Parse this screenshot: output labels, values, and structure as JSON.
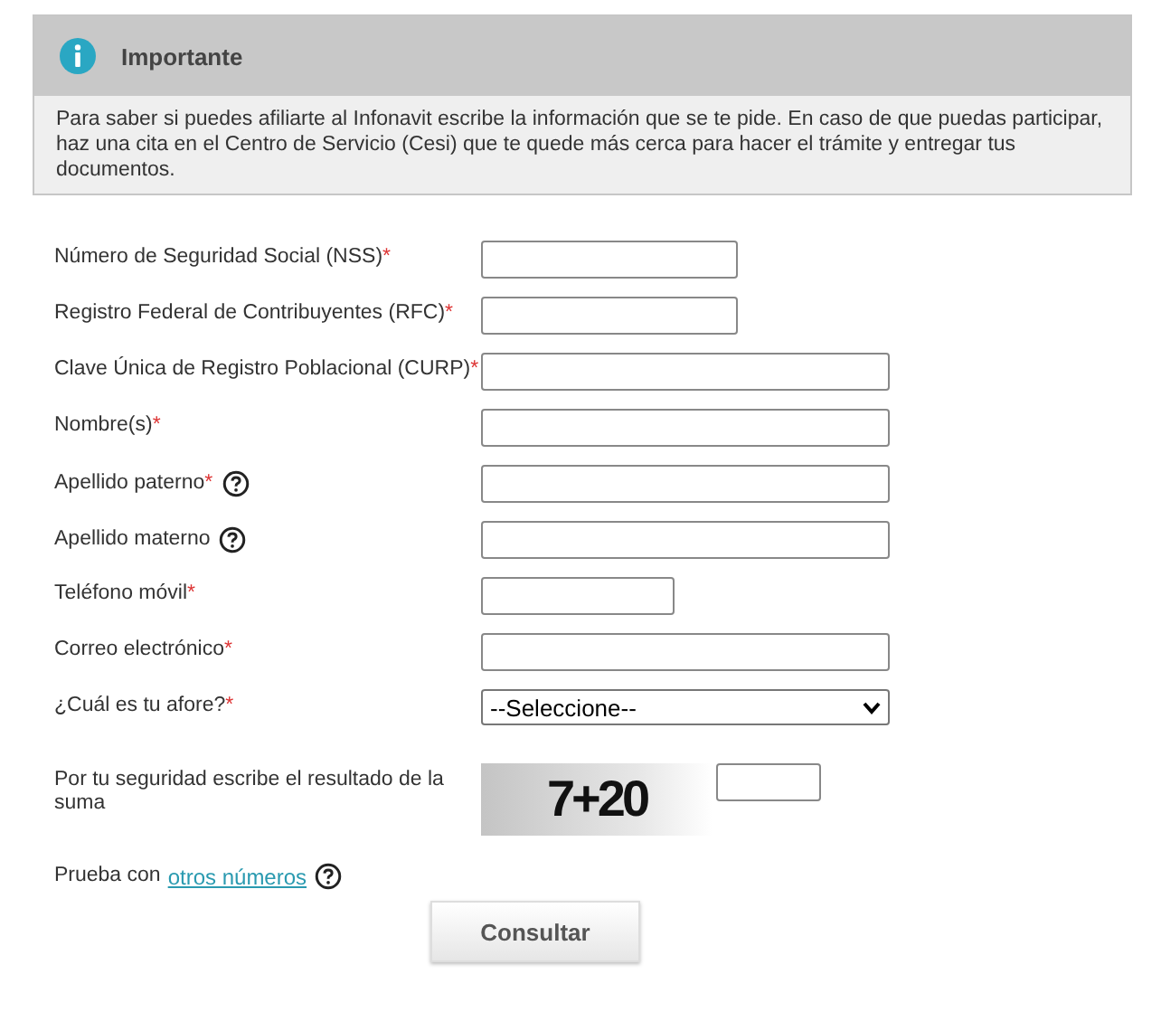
{
  "notice": {
    "title": "Importante",
    "text": "Para saber si puedes afiliarte al Infonavit escribe la información que se te pide. En caso de que puedas participar, haz una cita en el Centro de Servicio (Cesi) que te quede más cerca para hacer el trámite y entregar tus documentos."
  },
  "fields": [
    {
      "label": "Número de Seguridad Social (NSS)",
      "required_mark": "*",
      "help": false,
      "kind": "short"
    },
    {
      "label": "Registro Federal de Contribuyentes (RFC)",
      "required_mark": "*",
      "help": false,
      "kind": "short"
    },
    {
      "label": "Clave Única de Registro Poblacional (CURP)",
      "required_mark": "*",
      "help": false,
      "kind": "long"
    },
    {
      "label": "Nombre(s)",
      "required_mark": "*",
      "help": false,
      "kind": "long"
    },
    {
      "label": "Apellido paterno",
      "required_mark": "*",
      "help": true,
      "kind": "long"
    },
    {
      "label": "Apellido materno",
      "help": true,
      "kind": "long"
    },
    {
      "label": "Teléfono móvil",
      "required_mark": "*",
      "help": false,
      "kind": "phone"
    },
    {
      "label": "Correo electrónico",
      "required_mark": "*",
      "help": false,
      "kind": "long"
    },
    {
      "label": "¿Cuál es tu afore?",
      "required_mark": "*",
      "help": false,
      "kind": "select",
      "value": "--Seleccione--"
    }
  ],
  "captcha": {
    "label": "Por tu seguridad escribe el resultado de la suma",
    "challenge": "7+20"
  },
  "retry": {
    "text": "Prueba con",
    "link": "otros números"
  },
  "submit": "Consultar"
}
